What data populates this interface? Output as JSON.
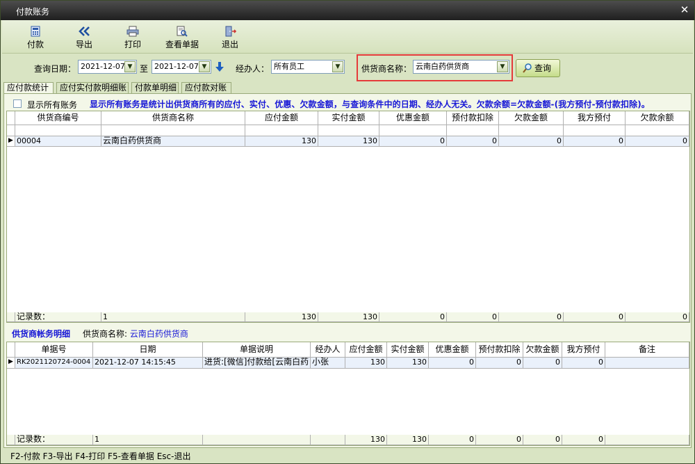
{
  "window": {
    "title": "付款账务"
  },
  "toolbar": {
    "pay": "付款",
    "export": "导出",
    "print": "打印",
    "view": "查看单据",
    "exit": "退出"
  },
  "query": {
    "date_label": "查询日期：",
    "date_from": "2021-12-07",
    "to_label": "至",
    "date_to": "2021-12-07",
    "handler_label": "经办人：",
    "handler": "所有员工",
    "supplier_label": "供货商名称：",
    "supplier": "云南白药供货商",
    "search_button": "查询"
  },
  "tabs": [
    "应付款统计",
    "应付实付款明细账",
    "付款单明细",
    "应付款对账"
  ],
  "summary": {
    "show_all_label": "显示所有账务",
    "notice": "显示所有账务是统计出供货商所有的应付、实付、优惠、欠款金额，与查询条件中的日期、经办人无关。欠款余额=欠款金额-(我方预付-预付款扣除)。",
    "columns": [
      "供货商编号",
      "供货商名称",
      "应付金额",
      "实付金额",
      "优惠金额",
      "预付款扣除",
      "欠款金额",
      "我方预付",
      "欠款余额"
    ],
    "rows": [
      [
        "00004",
        "云南白药供货商",
        "130",
        "130",
        "0",
        "0",
        "0",
        "0",
        "0"
      ]
    ],
    "footer_label": "记录数：",
    "footer": [
      "1",
      "130",
      "130",
      "0",
      "0",
      "0",
      "0",
      "0"
    ]
  },
  "detail": {
    "title": "供货商帐务明细",
    "supplier_label": "供货商名称:",
    "supplier": "云南白药供货商",
    "columns": [
      "单据号",
      "日期",
      "单据说明",
      "经办人",
      "应付金额",
      "实付金额",
      "优惠金额",
      "预付款扣除",
      "欠款金额",
      "我方预付",
      "备注"
    ],
    "rows": [
      [
        "RK2021120724-0004",
        "2021-12-07 14:15:45",
        "进货:[微信]付款给[云南白药",
        "小张",
        "130",
        "130",
        "0",
        "0",
        "0",
        "0",
        ""
      ]
    ],
    "footer_label": "记录数：",
    "footer": [
      "1",
      "",
      "",
      "130",
      "130",
      "0",
      "0",
      "0",
      "0",
      ""
    ]
  },
  "statusbar": "F2-付款 F3-导出 F4-打印 F5-查看单据 Esc-退出",
  "colors": {
    "panel_bg": "#d9e4c3",
    "notice_blue": "#1717d6",
    "highlight_red": "#e53a3a"
  }
}
